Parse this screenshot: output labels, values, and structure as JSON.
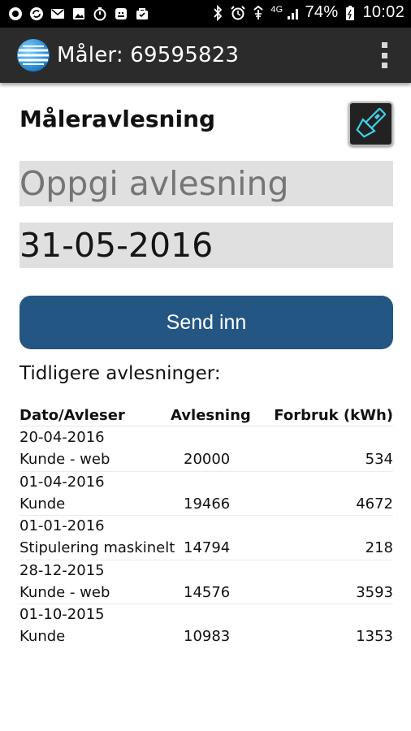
{
  "status_bar": {
    "battery": "74%",
    "time": "10:02",
    "network": "4G",
    "left_icons": [
      "record-icon",
      "sync-icon",
      "mail-icon",
      "image-icon",
      "stopwatch-icon",
      "android-icon",
      "bag-icon"
    ],
    "right_icons": [
      "bluetooth-icon",
      "alarm-icon",
      "wifi-icon",
      "signal-icon",
      "battery-icon"
    ]
  },
  "app_bar": {
    "title": "Måler: 69595823",
    "logo_icon": "globe-logo-icon",
    "menu_icon": "overflow-menu-icon"
  },
  "form": {
    "heading": "Måleravlesning",
    "flashlight_icon": "flashlight-icon",
    "reading_placeholder": "Oppgi avlesning",
    "reading_value": "",
    "date_value": "31-05-2016",
    "submit_label": "Send inn"
  },
  "history": {
    "label": "Tidligere avlesninger:",
    "columns": [
      "Dato/Avleser",
      "Avlesning",
      "Forbruk (kWh)"
    ],
    "rows": [
      {
        "date": "20-04-2016",
        "reader": "Kunde - web",
        "reading": "20000",
        "usage": "534"
      },
      {
        "date": "01-04-2016",
        "reader": "Kunde",
        "reading": "19466",
        "usage": "4672"
      },
      {
        "date": "01-01-2016",
        "reader": "Stipulering maskinelt",
        "reading": "14794",
        "usage": "218"
      },
      {
        "date": "28-12-2015",
        "reader": "Kunde - web",
        "reading": "14576",
        "usage": "3593"
      },
      {
        "date": "01-10-2015",
        "reader": "Kunde",
        "reading": "10983",
        "usage": "1353"
      }
    ]
  },
  "colors": {
    "app_bar": "#2b2b2b",
    "button": "#245683",
    "field_bg": "#e0e0e0",
    "placeholder": "#9a9a9a"
  }
}
